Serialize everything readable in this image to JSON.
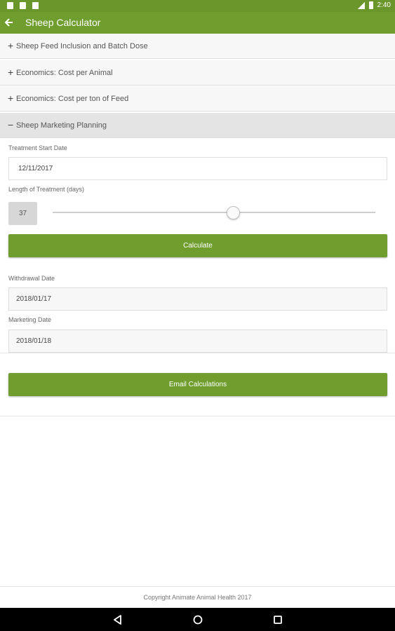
{
  "status_bar": {
    "time": "2:40",
    "icons": [
      "file-icon",
      "n-icon",
      "alert-icon",
      "signal-icon",
      "battery-icon"
    ]
  },
  "app_bar": {
    "title": "Sheep Calculator",
    "back_icon": "back-arrow-icon"
  },
  "sections": [
    {
      "symbol": "+",
      "label": "Sheep Feed Inclusion and Batch Dose",
      "expanded": false
    },
    {
      "symbol": "+",
      "label": "Economics: Cost per Animal",
      "expanded": false
    },
    {
      "symbol": "+",
      "label": "Economics: Cost per ton of Feed",
      "expanded": false
    },
    {
      "symbol": "−",
      "label": "Sheep Marketing Planning",
      "expanded": true
    }
  ],
  "form": {
    "start_date_label": "Treatment Start Date",
    "start_date_value": "12/11/2017",
    "length_label": "Length of Treatment (days)",
    "length_value": "37",
    "slider_fraction": 0.56,
    "calculate_label": "Calculate",
    "withdrawal_label": "Withdrawal Date",
    "withdrawal_value": "2018/01/17",
    "marketing_label": "Marketing Date",
    "marketing_value": "2018/01/18",
    "email_label": "Email Calculations"
  },
  "footer": {
    "copyright": "Copyright Animate Animal Health 2017"
  },
  "nav_bar": {
    "icons": [
      "nav-back-icon",
      "nav-home-icon",
      "nav-recents-icon"
    ]
  },
  "colors": {
    "primary": "#6f9e2f",
    "status_bar": "#6a962c",
    "section_bg": "#f7f7f7",
    "section_open_bg": "#e4e4e4"
  }
}
